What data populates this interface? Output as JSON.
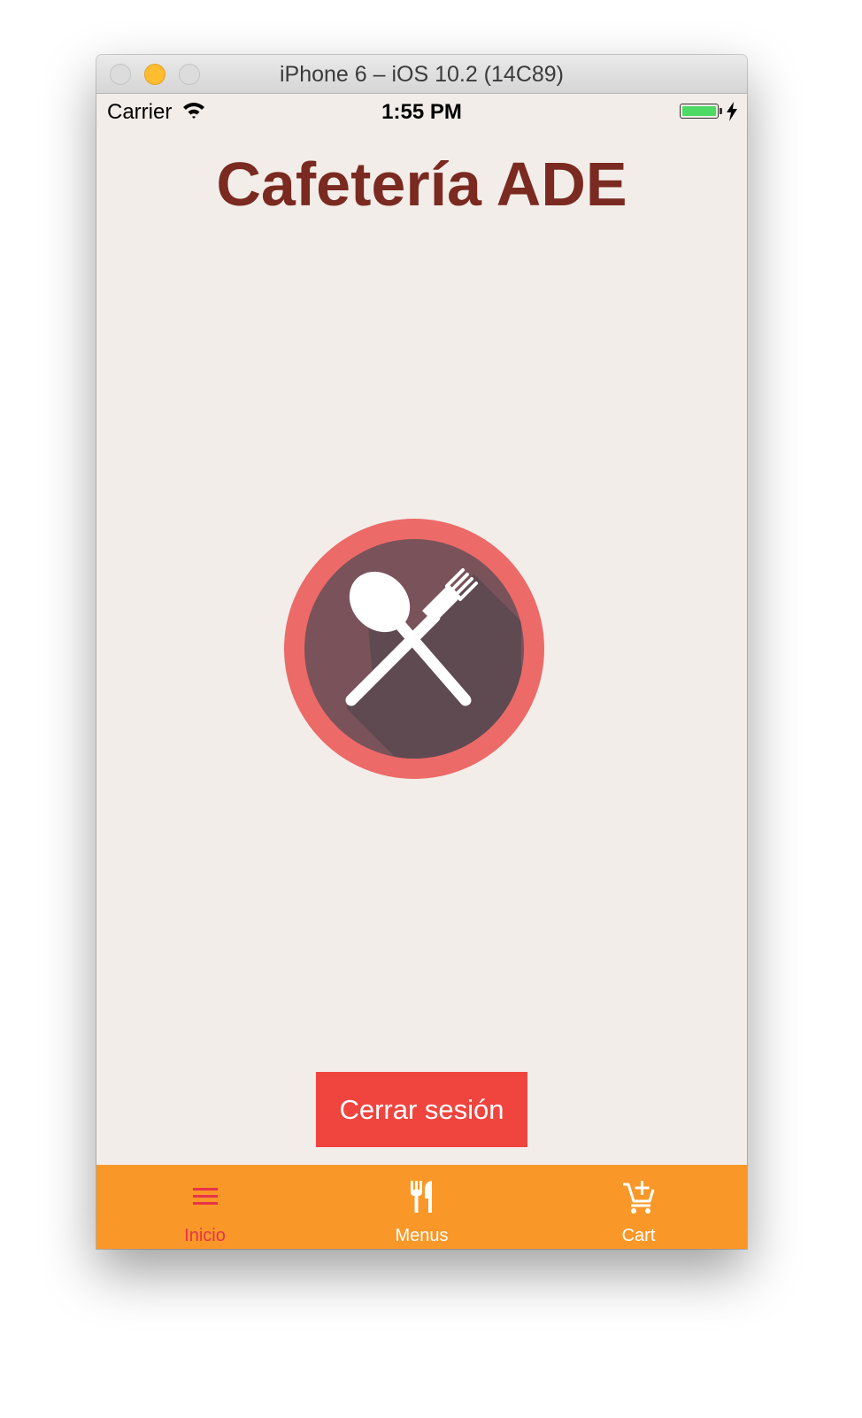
{
  "window": {
    "title": "iPhone 6 – iOS 10.2 (14C89)"
  },
  "status_bar": {
    "carrier": "Carrier",
    "time": "1:55 PM",
    "battery_level": 1.0
  },
  "app": {
    "title": "Cafetería ADE",
    "logout_label": "Cerrar sesión"
  },
  "tabs": [
    {
      "label": "Inicio",
      "icon": "menu-icon",
      "active": true
    },
    {
      "label": "Menus",
      "icon": "fork-knife-icon",
      "active": false
    },
    {
      "label": "Cart",
      "icon": "add-cart-icon",
      "active": false
    }
  ],
  "colors": {
    "title": "#7a2a20",
    "screen_background": "#f3ede9",
    "logout_button": "#f0443e",
    "tab_bar": "#f99828",
    "tab_active": "#e8334a",
    "tab_inactive": "#ffffff",
    "logo_ring": "#ec6a68",
    "logo_plate": "#7a535a"
  }
}
